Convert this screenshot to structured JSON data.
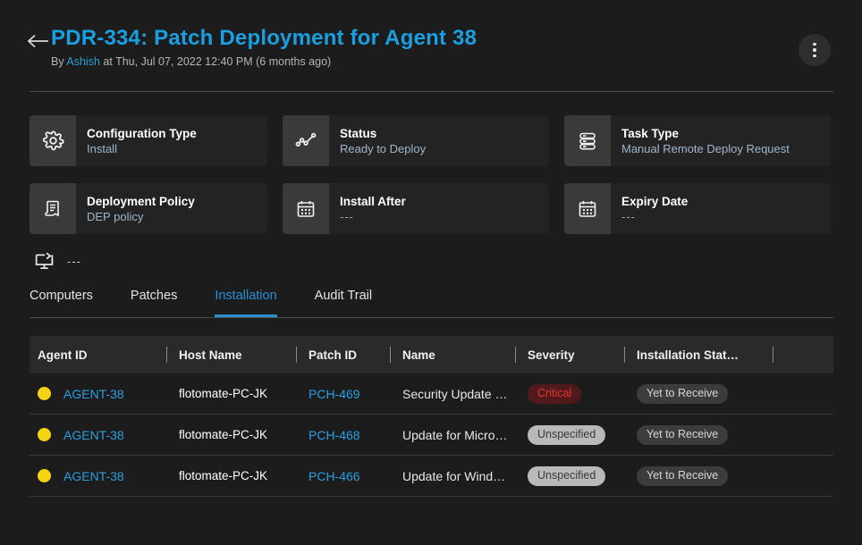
{
  "header": {
    "back_icon": "arrow-left-icon",
    "title": "PDR-334: Patch Deployment for Agent 38",
    "subtitle_prefix": "By",
    "author": "Ashish",
    "subtitle_suffix": "at Thu, Jul 07, 2022 12:40 PM (6 months ago)",
    "menu_icon": "kebab-menu-icon",
    "accent_color": "#1a9fe0"
  },
  "cards": [
    {
      "icon": "gear-icon",
      "label": "Configuration Type",
      "value": "Install"
    },
    {
      "icon": "line-chart-icon",
      "label": "Status",
      "value": "Ready to Deploy"
    },
    {
      "icon": "server-list-icon",
      "label": "Task Type",
      "value": "Manual Remote Deploy Request"
    },
    {
      "icon": "document-icon",
      "label": "Deployment Policy",
      "value": "DEP policy"
    },
    {
      "icon": "calendar-icon",
      "label": "Install After",
      "value": "---"
    },
    {
      "icon": "calendar-icon",
      "label": "Expiry Date",
      "value": "---"
    }
  ],
  "reboot": {
    "icon": "monitor-restart-icon",
    "value": "---"
  },
  "tabs": [
    {
      "label": "Computers",
      "active": false
    },
    {
      "label": "Patches",
      "active": false
    },
    {
      "label": "Installation",
      "active": true
    },
    {
      "label": "Audit Trail",
      "active": false
    }
  ],
  "table": {
    "columns": [
      "Agent ID",
      "Host Name",
      "Patch ID",
      "Name",
      "Severity",
      "Installation Stat…"
    ],
    "rows": [
      {
        "status_dot": "#f5d312",
        "agent_id": "AGENT-38",
        "host_name": "flotomate-PC-JK",
        "patch_id": "PCH-469",
        "name": "Security Update …",
        "severity": "Critical",
        "severity_style": "critical",
        "install_status": "Yet to Receive"
      },
      {
        "status_dot": "#f5d312",
        "agent_id": "AGENT-38",
        "host_name": "flotomate-PC-JK",
        "patch_id": "PCH-468",
        "name": "Update for Micro…",
        "severity": "Unspecified",
        "severity_style": "unspecified",
        "install_status": "Yet to Receive"
      },
      {
        "status_dot": "#f5d312",
        "agent_id": "AGENT-38",
        "host_name": "flotomate-PC-JK",
        "patch_id": "PCH-466",
        "name": "Update for Wind…",
        "severity": "Unspecified",
        "severity_style": "unspecified",
        "install_status": "Yet to Receive"
      }
    ]
  }
}
